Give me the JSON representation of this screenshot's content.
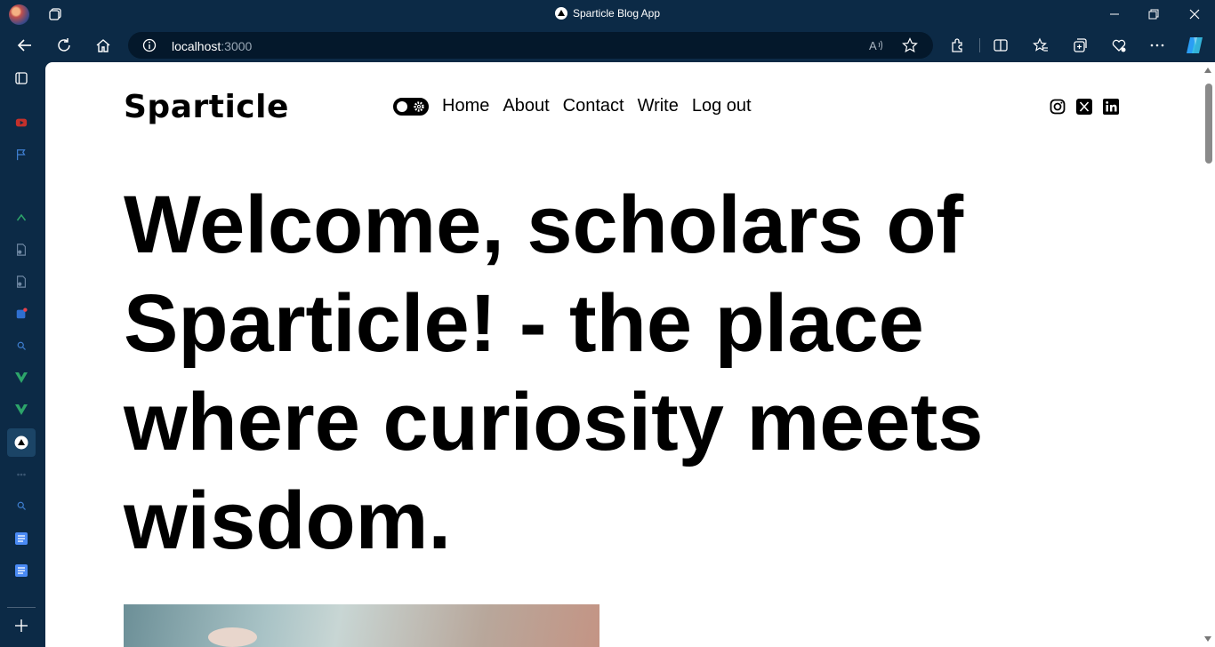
{
  "window": {
    "title": "Sparticle Blog App"
  },
  "address": {
    "host": "localhost",
    "port": ":3000"
  },
  "page": {
    "logo": "Sparticle",
    "nav": [
      {
        "label": "Home"
      },
      {
        "label": "About"
      },
      {
        "label": "Contact"
      },
      {
        "label": "Write"
      },
      {
        "label": "Log out"
      }
    ],
    "hero": {
      "bold": "Welcome, scholars of Sparticle!",
      "rest": " - the place where curiosity meets wisdom."
    },
    "social": [
      "instagram-icon",
      "x-icon",
      "linkedin-icon"
    ]
  },
  "colors": {
    "chrome": "#0c2a46",
    "urlbar": "#04182b",
    "page": "#ffffff",
    "text": "#000000"
  }
}
